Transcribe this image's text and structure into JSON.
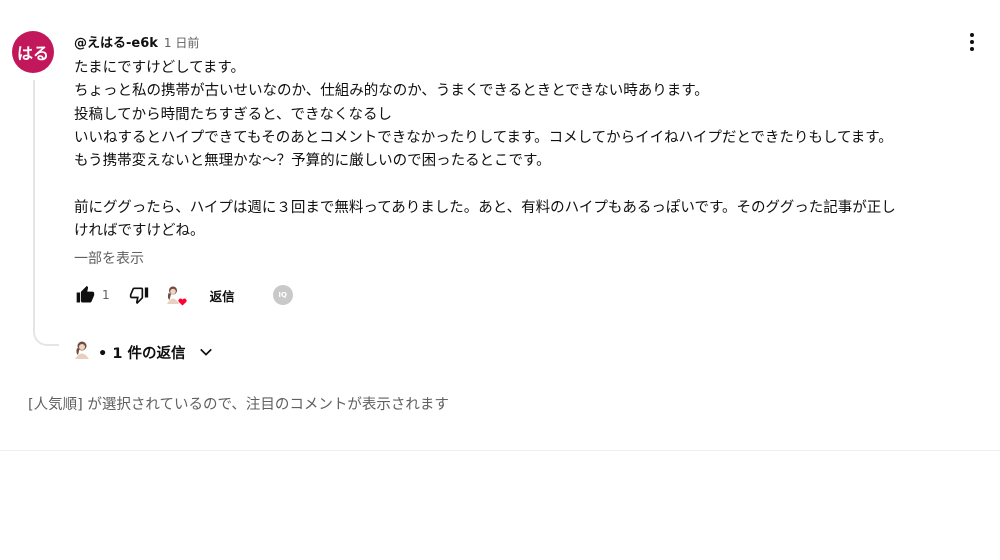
{
  "comment": {
    "avatar_text": "はる",
    "avatar_color": "#c2185b",
    "author": "@えはる-e6k",
    "time": "1 日前",
    "body_lines": [
      "たまにですけどしてます。",
      "ちょっと私の携帯が古いせいなのか、仕組み的なのか、うまくできるときとできない時あります。",
      "投稿してから時間たちすぎると、できなくなるし",
      "いいねするとハイプできてもそのあとコメントできなかったりしてます。コメしてからイイねハイプだとできたりもしてます。",
      "もう携帯変えないと無理かな～？予算的に厳しいので困ったるとこです。",
      "",
      "前にググったら、ハイプは週に３回まで無料ってありました。あと、有料のハイプもあるっぽいです。そのググった記事が正し",
      "ければですけどね。"
    ],
    "show_less": "一部を表示",
    "like_count": "1",
    "reply_label": "返信",
    "iq_badge": "IQ",
    "heart_color": "#ff0033"
  },
  "replies": {
    "label": "• 1 件の返信"
  },
  "notice": "[人気順] が選択されているので、注目のコメントが表示されます",
  "icons": {
    "like": "thumbs-up-icon",
    "dislike": "thumbs-down-icon",
    "menu": "more-vert-icon",
    "expand": "chevron-down-icon"
  }
}
